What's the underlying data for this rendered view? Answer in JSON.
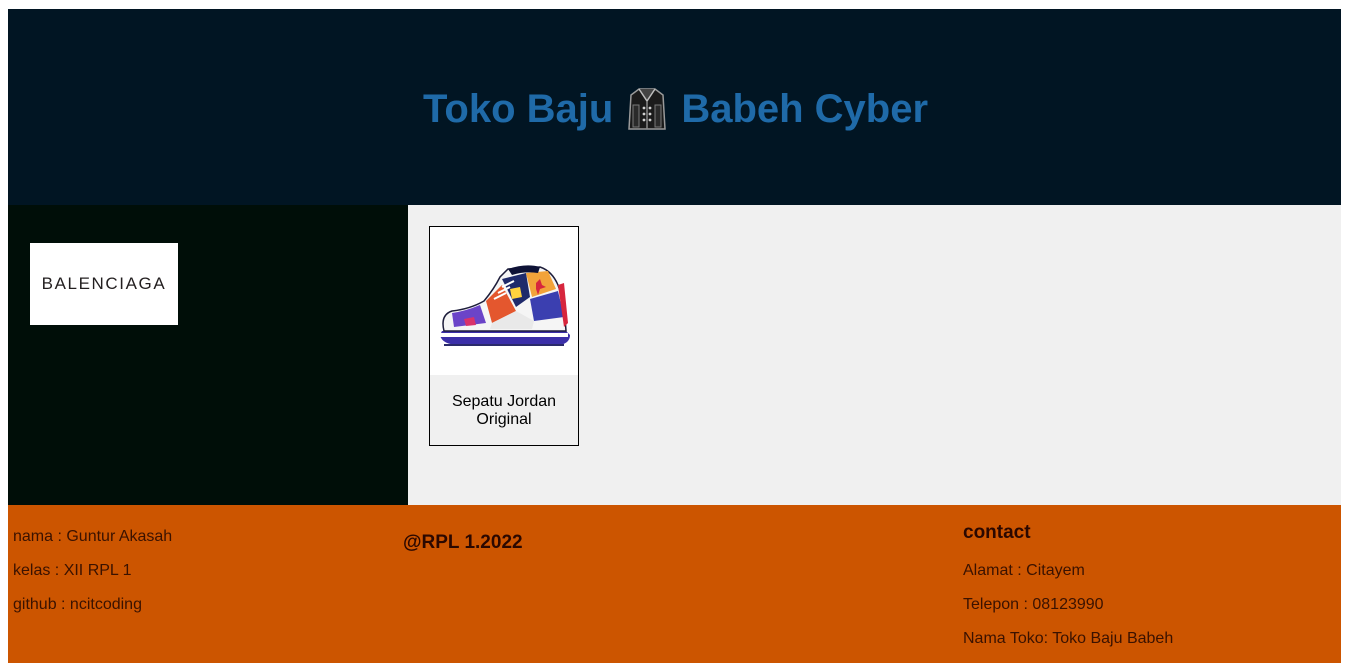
{
  "header": {
    "title_left": "Toko Baju",
    "title_icon": "jacket-icon",
    "title_right": "Babeh Cyber",
    "background": "#011523",
    "title_color": "#1f6aa8"
  },
  "sidebar": {
    "brand_logo_text": "BALENCIAGA",
    "background": "#000e08"
  },
  "main": {
    "background": "#f0f0f0",
    "products": [
      {
        "name": "Sepatu Jordan Original",
        "image": "sneaker-image"
      }
    ]
  },
  "footer": {
    "background": "#cc5500",
    "info": {
      "nama": "nama : Guntur Akasah",
      "kelas": "kelas : XII RPL 1",
      "github": "github : ncitcoding"
    },
    "copyright": "@RPL 1.2022",
    "contact": {
      "title": "contact",
      "alamat": "Alamat : Citayem",
      "telepon": "Telepon : 08123990",
      "nama_toko": "Nama Toko: Toko Baju Babeh"
    }
  }
}
